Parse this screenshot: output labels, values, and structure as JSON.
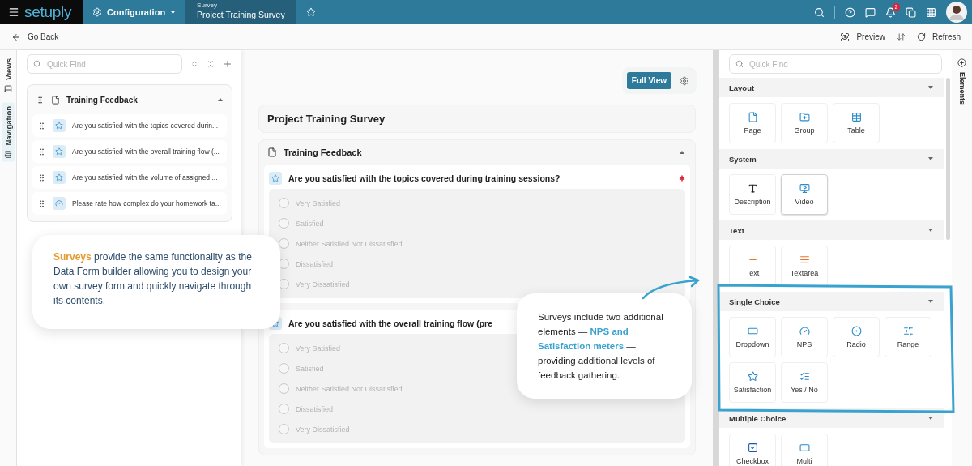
{
  "top_bar": {
    "logo": "setuply",
    "module": "Configuration",
    "breadcrumb": {
      "caption": "Survey",
      "title": "Project Training Survey"
    },
    "notification_count": "2"
  },
  "toolbar": {
    "back": "Go Back",
    "preview": "Preview",
    "refresh": "Refresh"
  },
  "side_tabs": [
    {
      "label": "Views",
      "selected": false
    },
    {
      "label": "Navigation",
      "selected": true
    }
  ],
  "navigator": {
    "search_placeholder": "Quick Find",
    "group": {
      "title": "Training Feedback",
      "expanded": true,
      "items": [
        {
          "label": "Are you satisfied with the topics covered durin...",
          "kind": "satisfaction"
        },
        {
          "label": "Are you satisfied with the overall training flow (...",
          "kind": "satisfaction"
        },
        {
          "label": "Are you satisfied with the volume of assigned ...",
          "kind": "satisfaction"
        },
        {
          "label": "Please rate how complex do your homework ta...",
          "kind": "nps"
        }
      ]
    }
  },
  "canvas": {
    "view_button": "Full View",
    "title": "Project Training Survey",
    "section": {
      "title": "Training Feedback",
      "expanded": true,
      "questions": [
        {
          "title": "Are you satisfied with the topics covered during training sessions?",
          "kind": "satisfaction",
          "required": true,
          "options": [
            {
              "label": "Very Satisfied",
              "selected": false
            },
            {
              "label": "Satisfied",
              "selected": false
            },
            {
              "label": "Neither Satisfied Nor Dissatisfied",
              "selected": false
            },
            {
              "label": "Dissatisfied",
              "selected": false
            },
            {
              "label": "Very Dissatisfied",
              "selected": false
            }
          ]
        },
        {
          "title": "Are you satisfied with the overall training flow (pre",
          "kind": "satisfaction",
          "required": false,
          "options": [
            {
              "label": "Very Satisfied",
              "selected": false
            },
            {
              "label": "Satisfied",
              "selected": false
            },
            {
              "label": "Neither Satisfied Nor Dissatisfied",
              "selected": false
            },
            {
              "label": "Dissatisfied",
              "selected": false
            },
            {
              "label": "Very Dissatisfied",
              "selected": false
            }
          ]
        }
      ]
    }
  },
  "elements_panel": {
    "tab": "Elements",
    "search_placeholder": "Quick Find",
    "groups": [
      {
        "title": "Layout",
        "items": [
          {
            "label": "Page",
            "kind": "page",
            "selected": false
          },
          {
            "label": "Group",
            "kind": "group",
            "selected": false
          },
          {
            "label": "Table",
            "kind": "table",
            "selected": false
          }
        ]
      },
      {
        "title": "System",
        "items": [
          {
            "label": "Description",
            "kind": "description",
            "selected": false
          },
          {
            "label": "Video",
            "kind": "video",
            "selected": true
          }
        ]
      },
      {
        "title": "Text",
        "items": [
          {
            "label": "Text",
            "kind": "text",
            "selected": false
          },
          {
            "label": "Textarea",
            "kind": "textarea",
            "selected": false
          }
        ]
      },
      {
        "title": "Single Choice",
        "items": [
          {
            "label": "Dropdown",
            "kind": "dropdown",
            "selected": false
          },
          {
            "label": "NPS",
            "kind": "nps",
            "selected": false
          },
          {
            "label": "Radio",
            "kind": "radio",
            "selected": false
          },
          {
            "label": "Range",
            "kind": "range",
            "selected": false
          },
          {
            "label": "Satisfaction",
            "kind": "satisfaction",
            "selected": false
          },
          {
            "label": "Yes / No",
            "kind": "yesno",
            "selected": false
          }
        ]
      },
      {
        "title": "Multiple Choice",
        "items": [
          {
            "label": "Checkbox",
            "kind": "checkbox",
            "selected": false
          },
          {
            "label": "Multi",
            "kind": "multi",
            "selected": false
          }
        ]
      }
    ]
  },
  "callouts": [
    {
      "kind": "orange",
      "text": "**Surveys** provide the same functionality as the Data Form builder allowing you to design your own survey form and quickly navigate through its contents."
    },
    {
      "kind": "blue",
      "text": "Surveys include two additional elements — **NPS and Satisfaction meters** — providing additional levels of feedback gathering."
    }
  ]
}
